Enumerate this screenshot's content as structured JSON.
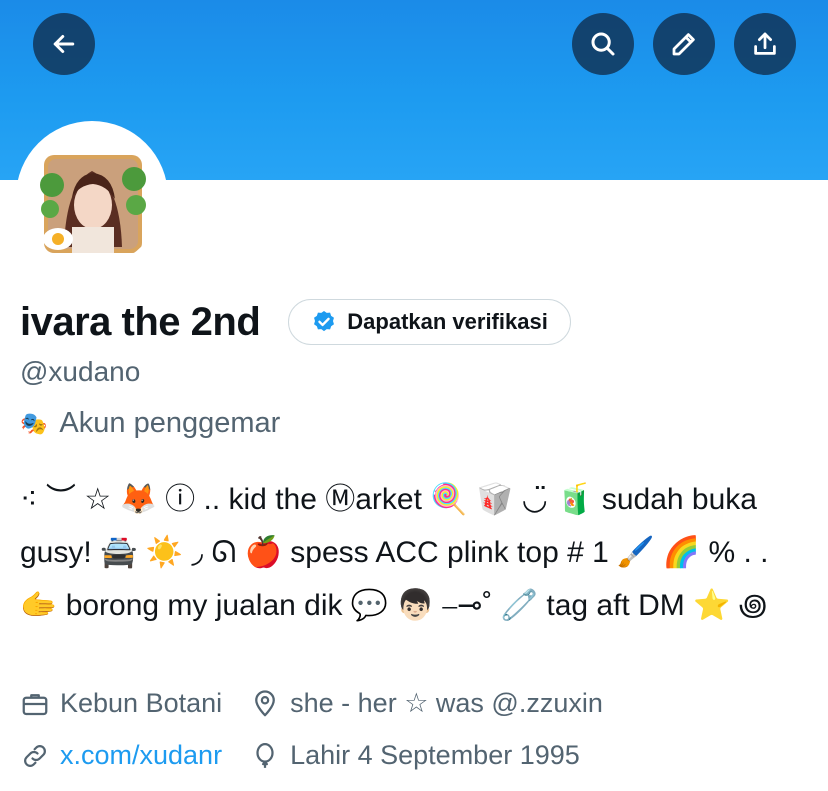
{
  "header": {
    "back_icon": "arrow-left-icon",
    "search_icon": "search-icon",
    "edit_icon": "pencil-icon",
    "share_icon": "share-upload-icon",
    "banner_color": "#1d9bf0",
    "button_bg": "#10304b"
  },
  "profile": {
    "display_name": "ivara the 2nd",
    "verify_label": "Dapatkan verifikasi",
    "handle": "@xudano",
    "category": "Akun penggemar",
    "category_icon": "🎭",
    "bio": "⁖ ︶ ☆ 🦊 ⓘ .. kid the Ⓜarket 🍭 🥡 ◡̈ 🧃 sudah buka gusy! 🚔 ☀️ ◞ ᘏ 🍎 spess ACC plink top # 1 🖌️ 🌈 % . . 🫱 borong my jualan dik 💬 👦🏻 ⎯⊸˚ 🧷 tag aft DM ⭐ ꩜",
    "location_work": "Kebun Botani",
    "location": "she - her ☆ was @.zzuxin",
    "website": "x.com/xudanr",
    "birthday": "Lahir 4 September 1995"
  },
  "colors": {
    "text_primary": "#0f1419",
    "text_secondary": "#536471",
    "link": "#1d9bf0",
    "verified_blue": "#1d9bf0"
  }
}
